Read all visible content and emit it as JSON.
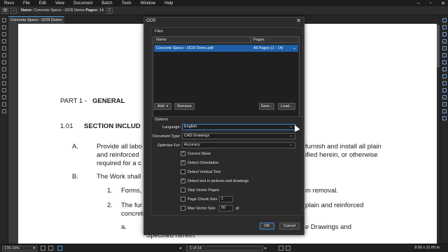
{
  "menu": [
    "Revu",
    "File",
    "Edit",
    "View",
    "Document",
    "Batch",
    "Tools",
    "Window",
    "Help"
  ],
  "toolbar": {
    "name_label": "Name:",
    "name_value": "Concrete Specs - OCR Demo",
    "pages_label": "Pages:",
    "pages_value": "14"
  },
  "tab": {
    "label": "Concrete Specs - OCR Demo",
    "close": "×"
  },
  "document": {
    "part": "PART 1 -",
    "part_title": "GENERAL",
    "sec_num": "1.01",
    "sec_title": "SECTION INCLUD",
    "a_label": "A.",
    "a_line1": "Provide all labo",
    "a_line1b": "furnish and install all plain",
    "a_line2": "and reinforced",
    "a_line2b": "ified herein, or otherwise",
    "a_line3": "required for a c",
    "b_label": "B.",
    "b_line1": "The Work shall",
    "i1_label": "1.",
    "i1_text": "Forms,",
    "i1_textb": "m removal.",
    "i2_label": "2.",
    "i2_text": "The fur",
    "i2_textb": "plain and reinforced",
    "i2_line2": "concrete",
    "ia_label": "a.",
    "ia_textb": "e Drawings and",
    "ia_line2": "Specified herein."
  },
  "status": {
    "zoom": "178.14%",
    "page_indicator": "1 of 14",
    "page_size": "8.50 x 11.00 in"
  },
  "dialog": {
    "title": "OCR",
    "files_group": "Files",
    "col_name": "Name",
    "col_pages": "Pages",
    "file_name": "Concrete Specs - OCR Demo.pdf",
    "file_pages": "All Pages (1 - 14)",
    "add_label": "Add",
    "remove_label": "Remove",
    "save_label": "Save...",
    "load_label": "Load...",
    "options_group": "Options",
    "language_label": "Language:",
    "language_value": "English",
    "doctype_label": "Document Type:",
    "doctype_value": "CAD Drawings",
    "optimize_label": "Optimize For:",
    "optimize_value": "Accuracy",
    "checks": [
      {
        "label": "Correct Skew",
        "checked": true
      },
      {
        "label": "Detect Orientation",
        "checked": true
      },
      {
        "label": "Detect Vertical Text",
        "checked": false
      },
      {
        "label": "Detect text in pictures and drawings",
        "checked": true
      },
      {
        "label": "Skip Vector Pages",
        "checked": false
      },
      {
        "label": "Page Chunk Size",
        "checked": false
      },
      {
        "label": "Max Vector Size",
        "checked": false
      }
    ],
    "chunk_value": "1",
    "vector_value": "50",
    "vector_unit": "pt",
    "ok_label": "OK",
    "cancel_label": "Cancel"
  }
}
